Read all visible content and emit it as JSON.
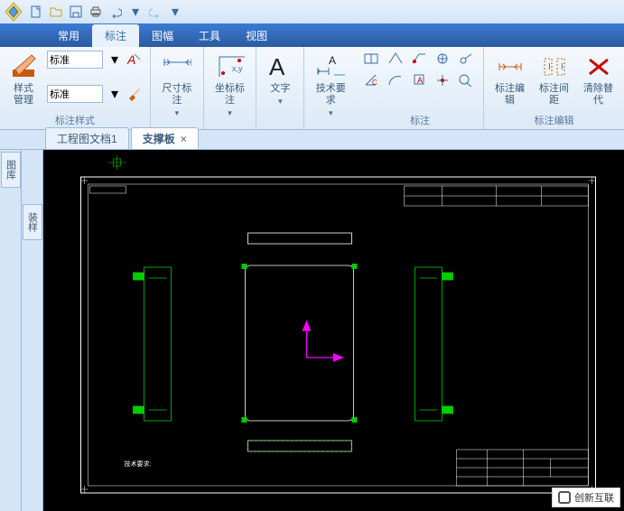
{
  "qat": {
    "tooltip": "Quick Access Toolbar"
  },
  "menu": {
    "tabs": [
      "常用",
      "标注",
      "图幅",
      "工具",
      "视图"
    ],
    "active": 1
  },
  "ribbon": {
    "groups": {
      "style": {
        "label": "标注样式",
        "manage": "样式管理",
        "combo1": "标准",
        "combo2": "标准"
      },
      "dim": {
        "label": "尺寸标注"
      },
      "coord": {
        "label": "坐标标注"
      },
      "text": {
        "label": "文字"
      },
      "tech": {
        "label": "技术要求"
      },
      "annot": {
        "label": "标注"
      },
      "edit": {
        "edit_label": "标注编辑",
        "gap_label": "标注间距",
        "clear_label": "清除替代",
        "group_label": "标注编辑"
      }
    }
  },
  "doc_tabs": {
    "items": [
      "工程图文档1",
      "支撑板"
    ],
    "active": 1
  },
  "side": {
    "btn1": "图库",
    "btn2": "装样"
  },
  "watermark": "创新互联"
}
